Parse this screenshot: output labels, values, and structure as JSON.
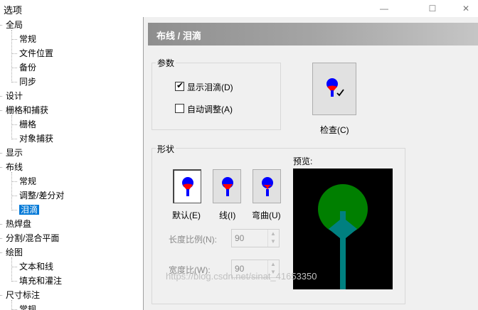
{
  "window": {
    "title": "选项",
    "min_label": "—",
    "max_label": "☐",
    "close_label": "✕"
  },
  "tree": {
    "items": [
      {
        "label": "全局",
        "level": 0
      },
      {
        "label": "常规",
        "level": 1
      },
      {
        "label": "文件位置",
        "level": 1
      },
      {
        "label": "备份",
        "level": 1
      },
      {
        "label": "同步",
        "level": 1
      },
      {
        "label": "设计",
        "level": 0
      },
      {
        "label": "栅格和捕获",
        "level": 0
      },
      {
        "label": "栅格",
        "level": 1
      },
      {
        "label": "对象捕获",
        "level": 1
      },
      {
        "label": "显示",
        "level": 0
      },
      {
        "label": "布线",
        "level": 0
      },
      {
        "label": "常规",
        "level": 1
      },
      {
        "label": "调整/差分对",
        "level": 1
      },
      {
        "label": "泪滴",
        "level": 1,
        "selected": true
      },
      {
        "label": "热焊盘",
        "level": 0
      },
      {
        "label": "分割/混合平面",
        "level": 0
      },
      {
        "label": "绘图",
        "level": 0
      },
      {
        "label": "文本和线",
        "level": 1
      },
      {
        "label": "填充和灌注",
        "level": 1
      },
      {
        "label": "尺寸标注",
        "level": 0
      },
      {
        "label": "常规",
        "level": 1
      }
    ]
  },
  "panel": {
    "header": "布线 / 泪滴",
    "params_group": "参数",
    "show_teardrops": "显示泪滴(D)",
    "auto_adjust": "自动调整(A)",
    "show_teardrops_checked": true,
    "auto_adjust_checked": false,
    "check_button": "检查(C)",
    "shape_group": "形状",
    "shapes": [
      "默认(E)",
      "线(I)",
      "弯曲(U)"
    ],
    "length_ratio_label": "长度比例(N):",
    "length_ratio_value": "90",
    "width_ratio_label": "宽度比(W):",
    "width_ratio_value": "90",
    "preview_label": "预览:"
  },
  "watermark": "https://blog.csdn.net/sinat_41653350",
  "colors": {
    "teardrop_blue": "#0000ff",
    "teardrop_red": "#ff0000",
    "preview_green": "#007f00",
    "preview_teal": "#008080",
    "selection": "#0078d7"
  }
}
